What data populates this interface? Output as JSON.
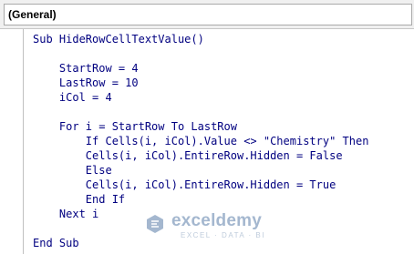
{
  "header": {
    "object_dropdown": "(General)"
  },
  "code_lines": [
    "Sub HideRowCellTextValue()",
    "",
    "    StartRow = 4",
    "    LastRow = 10",
    "    iCol = 4",
    "",
    "    For i = StartRow To LastRow",
    "        If Cells(i, iCol).Value <> \"Chemistry\" Then",
    "        Cells(i, iCol).EntireRow.Hidden = False",
    "        Else",
    "        Cells(i, iCol).EntireRow.Hidden = True",
    "        End If",
    "    Next i",
    "",
    "End Sub"
  ],
  "watermark": {
    "name": "exceldemy",
    "tagline": "EXCEL · DATA · BI",
    "color": "#5a7ea8"
  }
}
